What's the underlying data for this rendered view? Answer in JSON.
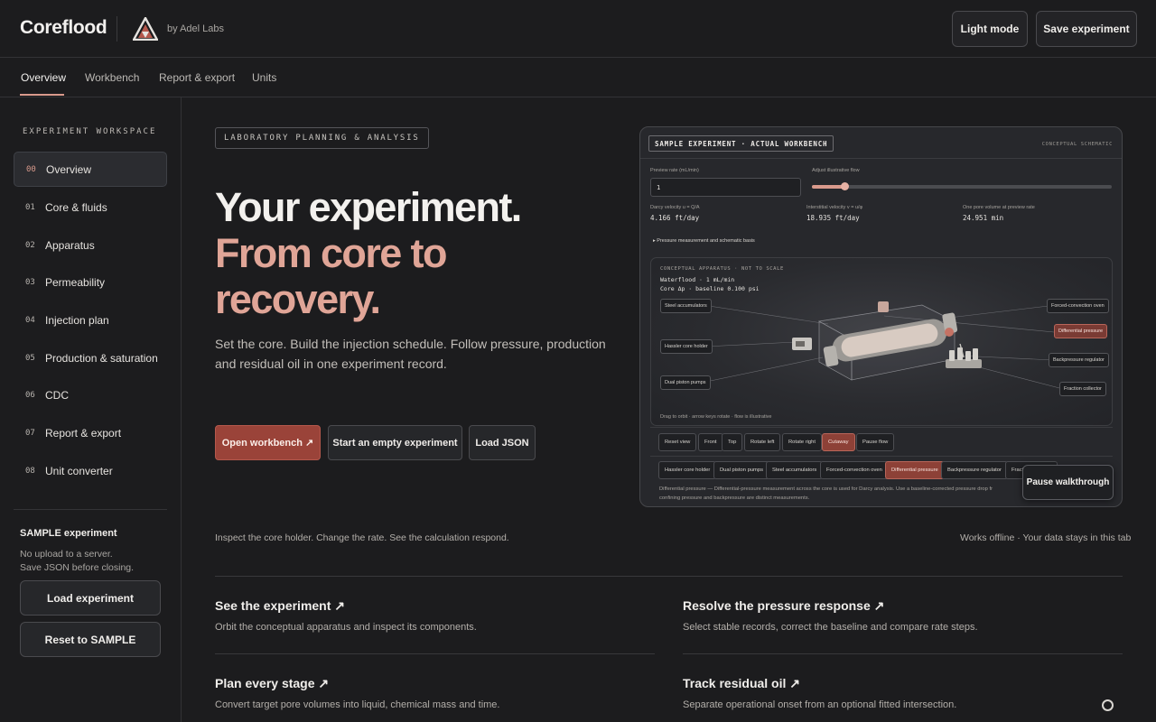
{
  "header": {
    "brand": "Coreflood",
    "byline": "by Adel Labs",
    "light_mode": "Light mode",
    "save_experiment": "Save experiment"
  },
  "nav": {
    "tabs": [
      {
        "label": "Overview",
        "active": true
      },
      {
        "label": "Workbench"
      },
      {
        "label": "Report & export"
      },
      {
        "label": "Units"
      }
    ]
  },
  "sidebar": {
    "heading": "EXPERIMENT WORKSPACE",
    "items": [
      {
        "num": "00",
        "label": "Overview",
        "active": true
      },
      {
        "num": "01",
        "label": "Core & fluids"
      },
      {
        "num": "02",
        "label": "Apparatus"
      },
      {
        "num": "03",
        "label": "Permeability"
      },
      {
        "num": "04",
        "label": "Injection plan"
      },
      {
        "num": "05",
        "label": "Production & saturation"
      },
      {
        "num": "06",
        "label": "CDC"
      },
      {
        "num": "07",
        "label": "Report & export"
      },
      {
        "num": "08",
        "label": "Unit converter"
      }
    ],
    "sample_title": "SAMPLE experiment",
    "sample_note_1": "No upload to a server.",
    "sample_note_2": "Save JSON before closing.",
    "load_experiment": "Load experiment",
    "reset_sample": "Reset to SAMPLE"
  },
  "hero": {
    "badge": "LABORATORY PLANNING & ANALYSIS",
    "line1": "Your experiment.",
    "line2": "From core to",
    "line3": "recovery.",
    "lead": "Set the core. Build the injection schedule. Follow pressure, production and residual oil in one experiment record.",
    "open_workbench": "Open workbench ↗",
    "start_empty": "Start an empty experiment",
    "load_json": "Load JSON",
    "caption_left": "Inspect the core holder. Change the rate. See the calculation respond.",
    "caption_right": "Works offline · Your data stays in this tab"
  },
  "preview": {
    "tag": "SAMPLE EXPERIMENT · ACTUAL WORKBENCH",
    "tag_right": "CONCEPTUAL SCHEMATIC",
    "rate_label": "Preview rate (mL/min)",
    "rate_value": "1",
    "slider_label": "Adjust illustrative flow",
    "slider_fraction": 0.11,
    "darcy_label": "Darcy velocity u = Q/A",
    "darcy_value": "4.166 ft/day",
    "interstitial_label": "Interstitial velocity v = u/φ",
    "interstitial_value": "18.935 ft/day",
    "pv_label": "One pore volume at preview rate",
    "pv_value": "24.951 min",
    "details": "▸ Pressure measurement and schematic basis",
    "sim_head": "CONCEPTUAL APPARATUS · NOT TO SCALE",
    "sim_line1": "Waterflood · 1 mL/min",
    "sim_line2": "Core Δp · baseline 0.100 psi",
    "labels": {
      "steel": "Steel accumulators",
      "hassler": "Hassler core holder",
      "dual": "Dual piston pumps",
      "oven": "Forced-convection oven",
      "diff": "Differential pressure",
      "bpr": "Backpressure regulator",
      "frac": "Fraction collector"
    },
    "drag_hint": "Drag to orbit · arrow keys rotate · flow is illustrative",
    "view_buttons": [
      "Reset view",
      "Front",
      "Top",
      "Rotate left",
      "Rotate right",
      "Cutaway",
      "Pause flow"
    ],
    "component_buttons": [
      "Hassler core holder",
      "Dual piston pumps",
      "Steel accumulators",
      "Forced-convection oven",
      "Differential pressure",
      "Backpressure regulator",
      "Fraction collector"
    ],
    "info_line1": "Differential pressure — Differential-pressure measurement across the core is used for Darcy analysis. Use a baseline-corrected pressure drop fr",
    "info_line2": "confining pressure and backpressure are distinct measurements.",
    "pause_walkthrough": "Pause walkthrough"
  },
  "features": [
    {
      "title": "See the experiment ↗",
      "desc": "Orbit the conceptual apparatus and inspect its components."
    },
    {
      "title": "Resolve the pressure response ↗",
      "desc": "Select stable records, correct the baseline and compare rate steps."
    },
    {
      "title": "Plan every stage ↗",
      "desc": "Convert target pore volumes into liquid, chemical mass and time."
    },
    {
      "title": "Track residual oil ↗",
      "desc": "Separate operational onset from an optional fitted intersection."
    }
  ],
  "colors": {
    "accent": "#d99a8c",
    "primary_button": "#9a4339",
    "background": "#1c1c1e"
  }
}
